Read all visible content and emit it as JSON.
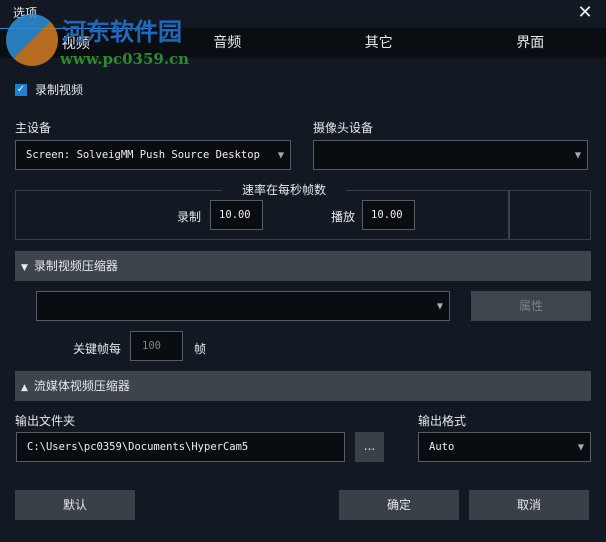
{
  "window": {
    "title": "选项",
    "close_icon": "close-icon"
  },
  "watermark": {
    "name": "河东软件园",
    "url": "www.pc0359.cn"
  },
  "tabs": [
    {
      "label": "视频",
      "active": true
    },
    {
      "label": "音频"
    },
    {
      "label": "其它"
    },
    {
      "label": "界面"
    }
  ],
  "record_video": {
    "label": "录制视频",
    "checked": true
  },
  "main_device": {
    "label": "主设备",
    "value": "Screen: SolveigMM Push Source Desktop Fi"
  },
  "camera_device": {
    "label": "摄像头设备",
    "value": ""
  },
  "fps": {
    "legend": "速率在每秒帧数",
    "record_label": "录制",
    "record_value": "10.00",
    "play_label": "播放",
    "play_value": "10.00"
  },
  "compressor": {
    "header": "录制视频压缩器",
    "value": "",
    "properties_label": "属性",
    "keyframe_label": "关键帧每",
    "keyframe_value": "100",
    "keyframe_unit": "帧"
  },
  "stream_compressor": {
    "header": "流媒体视频压缩器"
  },
  "output": {
    "folder_label": "输出文件夹",
    "folder_value": "C:\\Users\\pc0359\\Documents\\HyperCam5",
    "browse_label": "...",
    "format_label": "输出格式",
    "format_value": "Auto"
  },
  "buttons": {
    "default": "默认",
    "ok": "确定",
    "cancel": "取消"
  }
}
